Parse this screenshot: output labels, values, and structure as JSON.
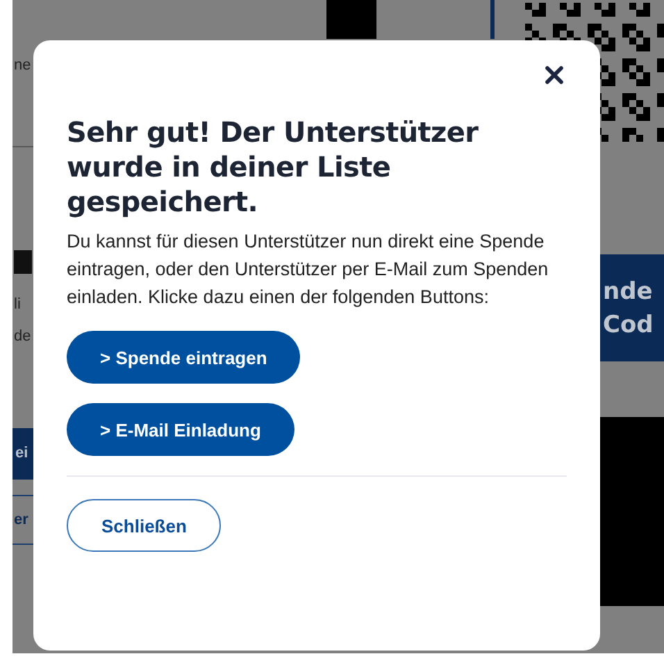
{
  "background": {
    "field_text": "ne",
    "text_lines": [
      "li",
      "de"
    ],
    "button_text": "ei",
    "outline_button_text": "er",
    "banner_lines": [
      "nde",
      "Cod"
    ]
  },
  "dialog": {
    "title": "Sehr gut! Der Unterstützer wurde in deiner Liste gespeichert.",
    "body": "Du kannst für diesen Unterstützer nun direkt eine Spende eintragen, oder den Unterstützer per E-Mail zum Spenden einladen. Klicke dazu einen der folgenden Buttons:",
    "actions": [
      {
        "label": "> Spende eintragen",
        "kind": "primary"
      },
      {
        "label": "> E-Mail Einladung",
        "kind": "primary"
      }
    ],
    "footer_buttons": [
      {
        "label": "Schließen",
        "kind": "outline"
      }
    ]
  }
}
